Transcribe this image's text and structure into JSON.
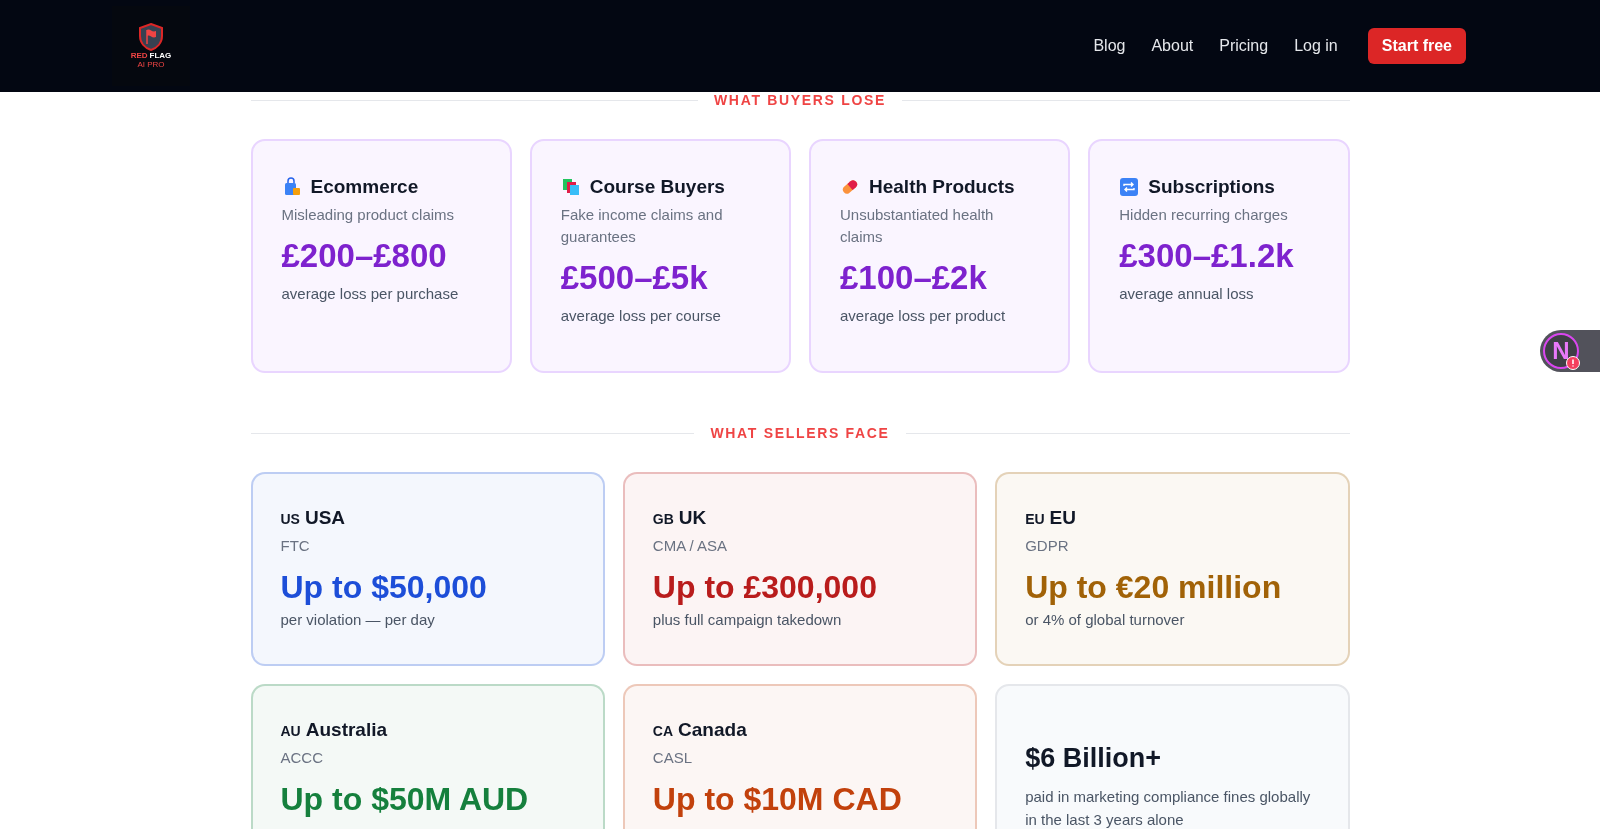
{
  "header": {
    "logo": {
      "word_1": "RED",
      "word_2": "FLAG",
      "tagline": "AI PRO"
    },
    "nav": [
      "Blog",
      "About",
      "Pricing",
      "Log in"
    ],
    "cta": "Start free"
  },
  "buyers": {
    "heading": "WHAT BUYERS LOSE",
    "cards": [
      {
        "title": "Ecommerce",
        "subtitle": "Misleading product claims",
        "amount": "£200–£800",
        "note": "average loss per purchase"
      },
      {
        "title": "Course Buyers",
        "subtitle": "Fake income claims and guarantees",
        "amount": "£500–£5k",
        "note": "average loss per course"
      },
      {
        "title": "Health Products",
        "subtitle": "Unsubstantiated health claims",
        "amount": "£100–£2k",
        "note": "average loss per product"
      },
      {
        "title": "Subscriptions",
        "subtitle": "Hidden recurring charges",
        "amount": "£300–£1.2k",
        "note": "average annual loss"
      }
    ]
  },
  "sellers": {
    "heading": "WHAT SELLERS FACE",
    "cards": [
      {
        "kind": "region",
        "code": "US",
        "name": "USA",
        "regulator": "FTC",
        "amount": "Up to $50,000",
        "note": "per violation — per day",
        "color": "#1d4ed8"
      },
      {
        "kind": "region",
        "code": "GB",
        "name": "UK",
        "regulator": "CMA / ASA",
        "amount": "Up to £300,000",
        "note": "plus full campaign takedown",
        "color": "#b91c1c"
      },
      {
        "kind": "region",
        "code": "EU",
        "name": "EU",
        "regulator": "GDPR",
        "amount": "Up to €20 million",
        "note": "or 4% of global turnover",
        "color": "#a16207"
      },
      {
        "kind": "region",
        "code": "AU",
        "name": "Australia",
        "regulator": "ACCC",
        "amount": "Up to $50M AUD",
        "color": "#15803d"
      },
      {
        "kind": "region",
        "code": "CA",
        "name": "Canada",
        "regulator": "CASL",
        "amount": "Up to $10M CAD",
        "color": "#c2410c"
      },
      {
        "kind": "stat",
        "amount": "$6 Billion+",
        "note": "paid in marketing compliance fines globally in the last 3 years alone"
      }
    ]
  },
  "floating_widget": {
    "letter": "N"
  }
}
